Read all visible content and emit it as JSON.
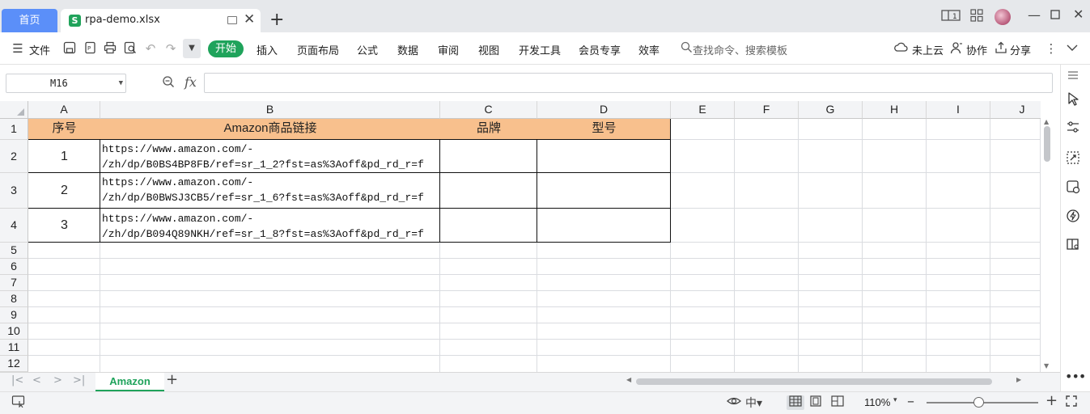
{
  "titlebar": {
    "home_tab": "首页",
    "file_tab": "rpa-demo.xlsx",
    "file_icon_letter": "S",
    "icons": [
      "window-pin-icon",
      "tab-close-icon",
      "new-tab-icon",
      "layout-1-icon",
      "grid-apps-icon",
      "avatar",
      "minimize-icon",
      "maximize-icon",
      "close-icon"
    ]
  },
  "ribbon": {
    "menu_label": "文件",
    "tabs": [
      "开始",
      "插入",
      "页面布局",
      "公式",
      "数据",
      "审阅",
      "视图",
      "开发工具",
      "会员专享",
      "效率"
    ],
    "search_placeholder": "查找命令、搜索模板",
    "cloud_label": "未上云",
    "collab_label": "协作",
    "share_label": "分享"
  },
  "formula_bar": {
    "cell_ref": "M16",
    "fx_label": "fx",
    "formula": ""
  },
  "grid": {
    "columns": [
      "A",
      "B",
      "C",
      "D",
      "E",
      "F",
      "G",
      "H",
      "I",
      "J"
    ],
    "rows": [
      "1",
      "2",
      "3",
      "4",
      "5",
      "6",
      "7",
      "8",
      "9",
      "10",
      "11",
      "12"
    ],
    "header_row": [
      "序号",
      "Amazon商品链接",
      "品牌",
      "型号"
    ],
    "header_fill": "#f8c08d",
    "data_rows": [
      {
        "seq": "1",
        "url_line1": "https://www.amazon.com/-",
        "url_line2": "/zh/dp/B0BS4BP8FB/ref=sr_1_2?fst=as%3Aoff&pd_rd_r=f",
        "brand": "",
        "model": ""
      },
      {
        "seq": "2",
        "url_line1": "https://www.amazon.com/-",
        "url_line2": "/zh/dp/B0BWSJ3CB5/ref=sr_1_6?fst=as%3Aoff&pd_rd_r=f",
        "brand": "",
        "model": ""
      },
      {
        "seq": "3",
        "url_line1": "https://www.amazon.com/-",
        "url_line2": "/zh/dp/B094Q89NKH/ref=sr_1_8?fst=as%3Aoff&pd_rd_r=f",
        "brand": "",
        "model": ""
      }
    ]
  },
  "sheets": {
    "active": "Amazon"
  },
  "status": {
    "zoom": "110%",
    "zoom_fraction": 0.47
  },
  "colors": {
    "accent_green": "#1fa35b",
    "home_tab_blue": "#5b8ff9"
  }
}
